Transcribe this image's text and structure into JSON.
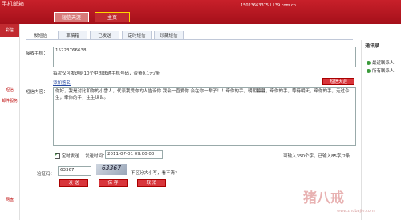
{
  "header": {
    "logo_text": "手机邮箱",
    "tabs": [
      {
        "label": "短信天涯"
      },
      {
        "label": "主页"
      }
    ],
    "account": "15023663375 l 139.com.cn"
  },
  "left_nav": {
    "badge": "彩信",
    "items": [
      {
        "label": "短信"
      },
      {
        "label": "邮件服务"
      },
      {
        "label": "网盘"
      }
    ]
  },
  "tabs": [
    {
      "label": "发短信"
    },
    {
      "label": "草稿箱"
    },
    {
      "label": "已发送"
    },
    {
      "label": "定时短信"
    },
    {
      "label": "珍藏短信"
    }
  ],
  "form": {
    "recipient_label": "接收手机：",
    "recipient_value": "15223766638",
    "hint": "每次仅可发送给10个中国联通手机号码，资费0.1元/条",
    "add_signature": "添加签名",
    "sms_heaven_button": "短信天涯",
    "content_label": "短信内容：",
    "content_value": "你好，我是对比和你的小雪人，代表我爱你的人告诉你 我会一直爱你 会在你一辈子！！牵你的手，朝朝暮暮，牵你的手，等待明天，牵你的手，走过今生，牵你的手，生生世世。",
    "scheduled_label": "定时发送",
    "send_time_label": "发送时间：",
    "send_time_value": "2011-07-01 09:00:00",
    "char_counter": "可输入350个字，已输入85字/2条",
    "captcha_label": "验证码：",
    "captcha_value": "63367",
    "captcha_image_text": "63367",
    "captcha_hint": "不区分大小写，看不清?",
    "buttons": {
      "send": "发 送",
      "save": "保 存",
      "cancel": "取 消"
    }
  },
  "right_panel": {
    "title": "通讯录",
    "items": [
      {
        "label": "最近联系人"
      },
      {
        "label": "所有联系人"
      }
    ]
  },
  "watermark": {
    "text": "猪八戒",
    "url": "www.zhubajie.com"
  }
}
